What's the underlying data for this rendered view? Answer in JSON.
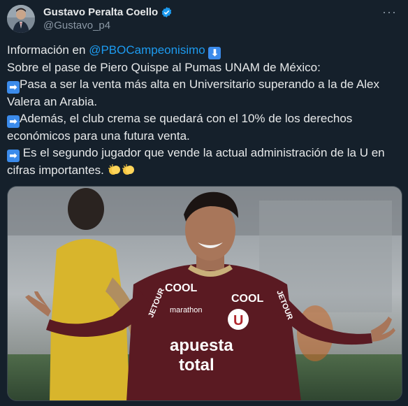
{
  "author": {
    "display_name": "Gustavo Peralta Coello",
    "handle": "@Gustavo_p4"
  },
  "menu_icon": "more-options-icon",
  "tweet": {
    "line1_prefix": "Información en ",
    "line1_mention": "@PBOCampeonisimo",
    "line2": "Sobre el pase de Piero Quispe al Pumas UNAM de México:",
    "line3": "Pasa a ser la venta más alta en Universitario superando a la de Alex Valera an Arabia.",
    "line4": "Además, el club crema se quedará con el 10% de los derechos económicos para una futura venta.",
    "line5": " Es el segundo jugador que vende la actual administración de la U en cifras importantes."
  },
  "media": {
    "jersey_text": {
      "sponsor_chest_1": "apuesta",
      "sponsor_chest_2": "total",
      "cool_left": "COOL",
      "cool_right": "COOL",
      "marathon": "marathon",
      "jetour_left": "JETOUR",
      "jetour_right": "JETOUR"
    }
  },
  "colors": {
    "background": "#15202b",
    "link": "#1d9bf0",
    "verified": "#1d9bf0",
    "jersey": "#5a1a22"
  }
}
